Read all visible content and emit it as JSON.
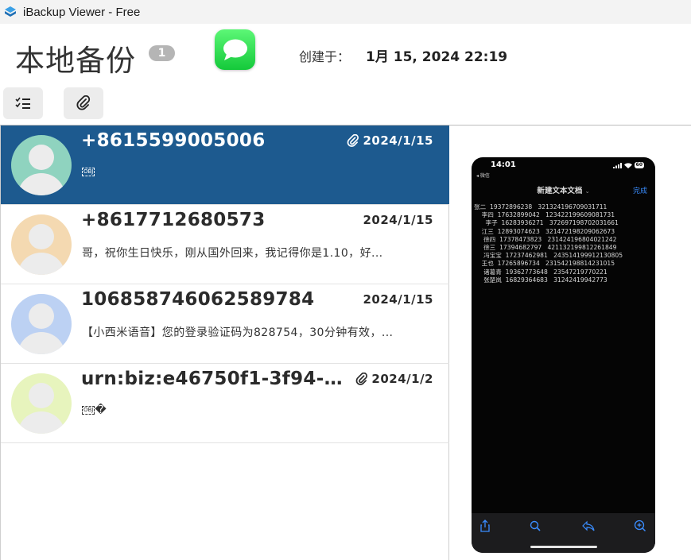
{
  "window": {
    "title": "iBackup Viewer - Free"
  },
  "header": {
    "page_title": "本地备份",
    "count_badge": "1",
    "created_label": "创建于：",
    "created_value": "1月 15, 2024 22:19"
  },
  "conversations": [
    {
      "name": "+8615599005006",
      "date": "2024/1/15",
      "has_attachment": true,
      "preview": "",
      "preview_object": "OBJ",
      "selected": true,
      "avatar_color": "#8fd3bf"
    },
    {
      "name": "+8617712680573",
      "date": "2024/1/15",
      "has_attachment": false,
      "preview": "哥，祝你生日快乐，刚从国外回来，我记得你是1.10，好...",
      "preview_object": "",
      "selected": false,
      "avatar_color": "#f4d9b1"
    },
    {
      "name": "106858746062589784",
      "date": "2024/1/15",
      "has_attachment": false,
      "preview": "【小西米语音】您的登录验证码为828754，30分钟有效，...",
      "preview_object": "",
      "selected": false,
      "avatar_color": "#bcd1f3"
    },
    {
      "name": "urn:biz:e46750f1-3f94-4...",
      "date": "2024/1/2",
      "has_attachment": true,
      "preview": "�",
      "preview_object": "OBJ",
      "selected": false,
      "avatar_color": "#e7f4bd"
    }
  ],
  "phone": {
    "time": "14:01",
    "back_label": "◂ 微信",
    "battery": "60",
    "nav_title": "新建文本文档",
    "done_label": "完成",
    "lines": [
      "张二  19372896238   321324196709031711",
      "    李四  17632899042   123422199609081731",
      "      李子  16283936271   372697198702031661",
      "    江三  12893074623   321472198209062673",
      "     徐四  17378473823   231424196804021242",
      "     徐三  17394682797   421132199812261849",
      "     冯宝宝  17237462981   243514199912130805",
      "    王也  17265896734   231542198814231015",
      "     诸葛青  19362773648   23547219770221",
      "     张楚岚  16829364683   31242419942773"
    ]
  },
  "colors": {
    "selected_row": "#1d5a8f",
    "badge": "#b5b5b5",
    "messages_green": "#28d14a"
  },
  "icons": [
    "app-logo-icon",
    "messages-icon",
    "checklist-icon",
    "paperclip-icon",
    "share-icon",
    "search-icon",
    "reply-icon",
    "zoom-icon"
  ]
}
